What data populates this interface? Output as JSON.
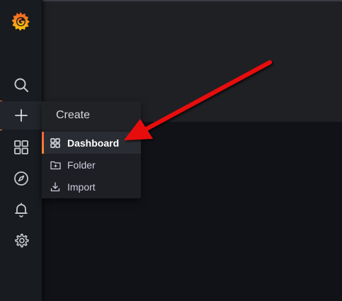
{
  "sidebar": {
    "logo_icon": "grafana-logo-icon",
    "items": [
      {
        "icon": "search-icon"
      },
      {
        "icon": "plus-icon",
        "active": true
      },
      {
        "icon": "dashboards-grid-icon"
      },
      {
        "icon": "compass-icon"
      },
      {
        "icon": "bell-icon"
      },
      {
        "icon": "gear-icon"
      }
    ]
  },
  "create_menu": {
    "title": "Create",
    "items": [
      {
        "label": "Dashboard",
        "icon": "dashboards-grid-icon",
        "selected": true
      },
      {
        "label": "Folder",
        "icon": "folder-plus-icon"
      },
      {
        "label": "Import",
        "icon": "import-icon"
      }
    ]
  },
  "colors": {
    "accent": "#ff8833",
    "accent_red": "#f55f3e",
    "annotation_arrow": "#e8100a",
    "sidebar_bg": "#181b1f",
    "canvas_bg": "#111217"
  }
}
